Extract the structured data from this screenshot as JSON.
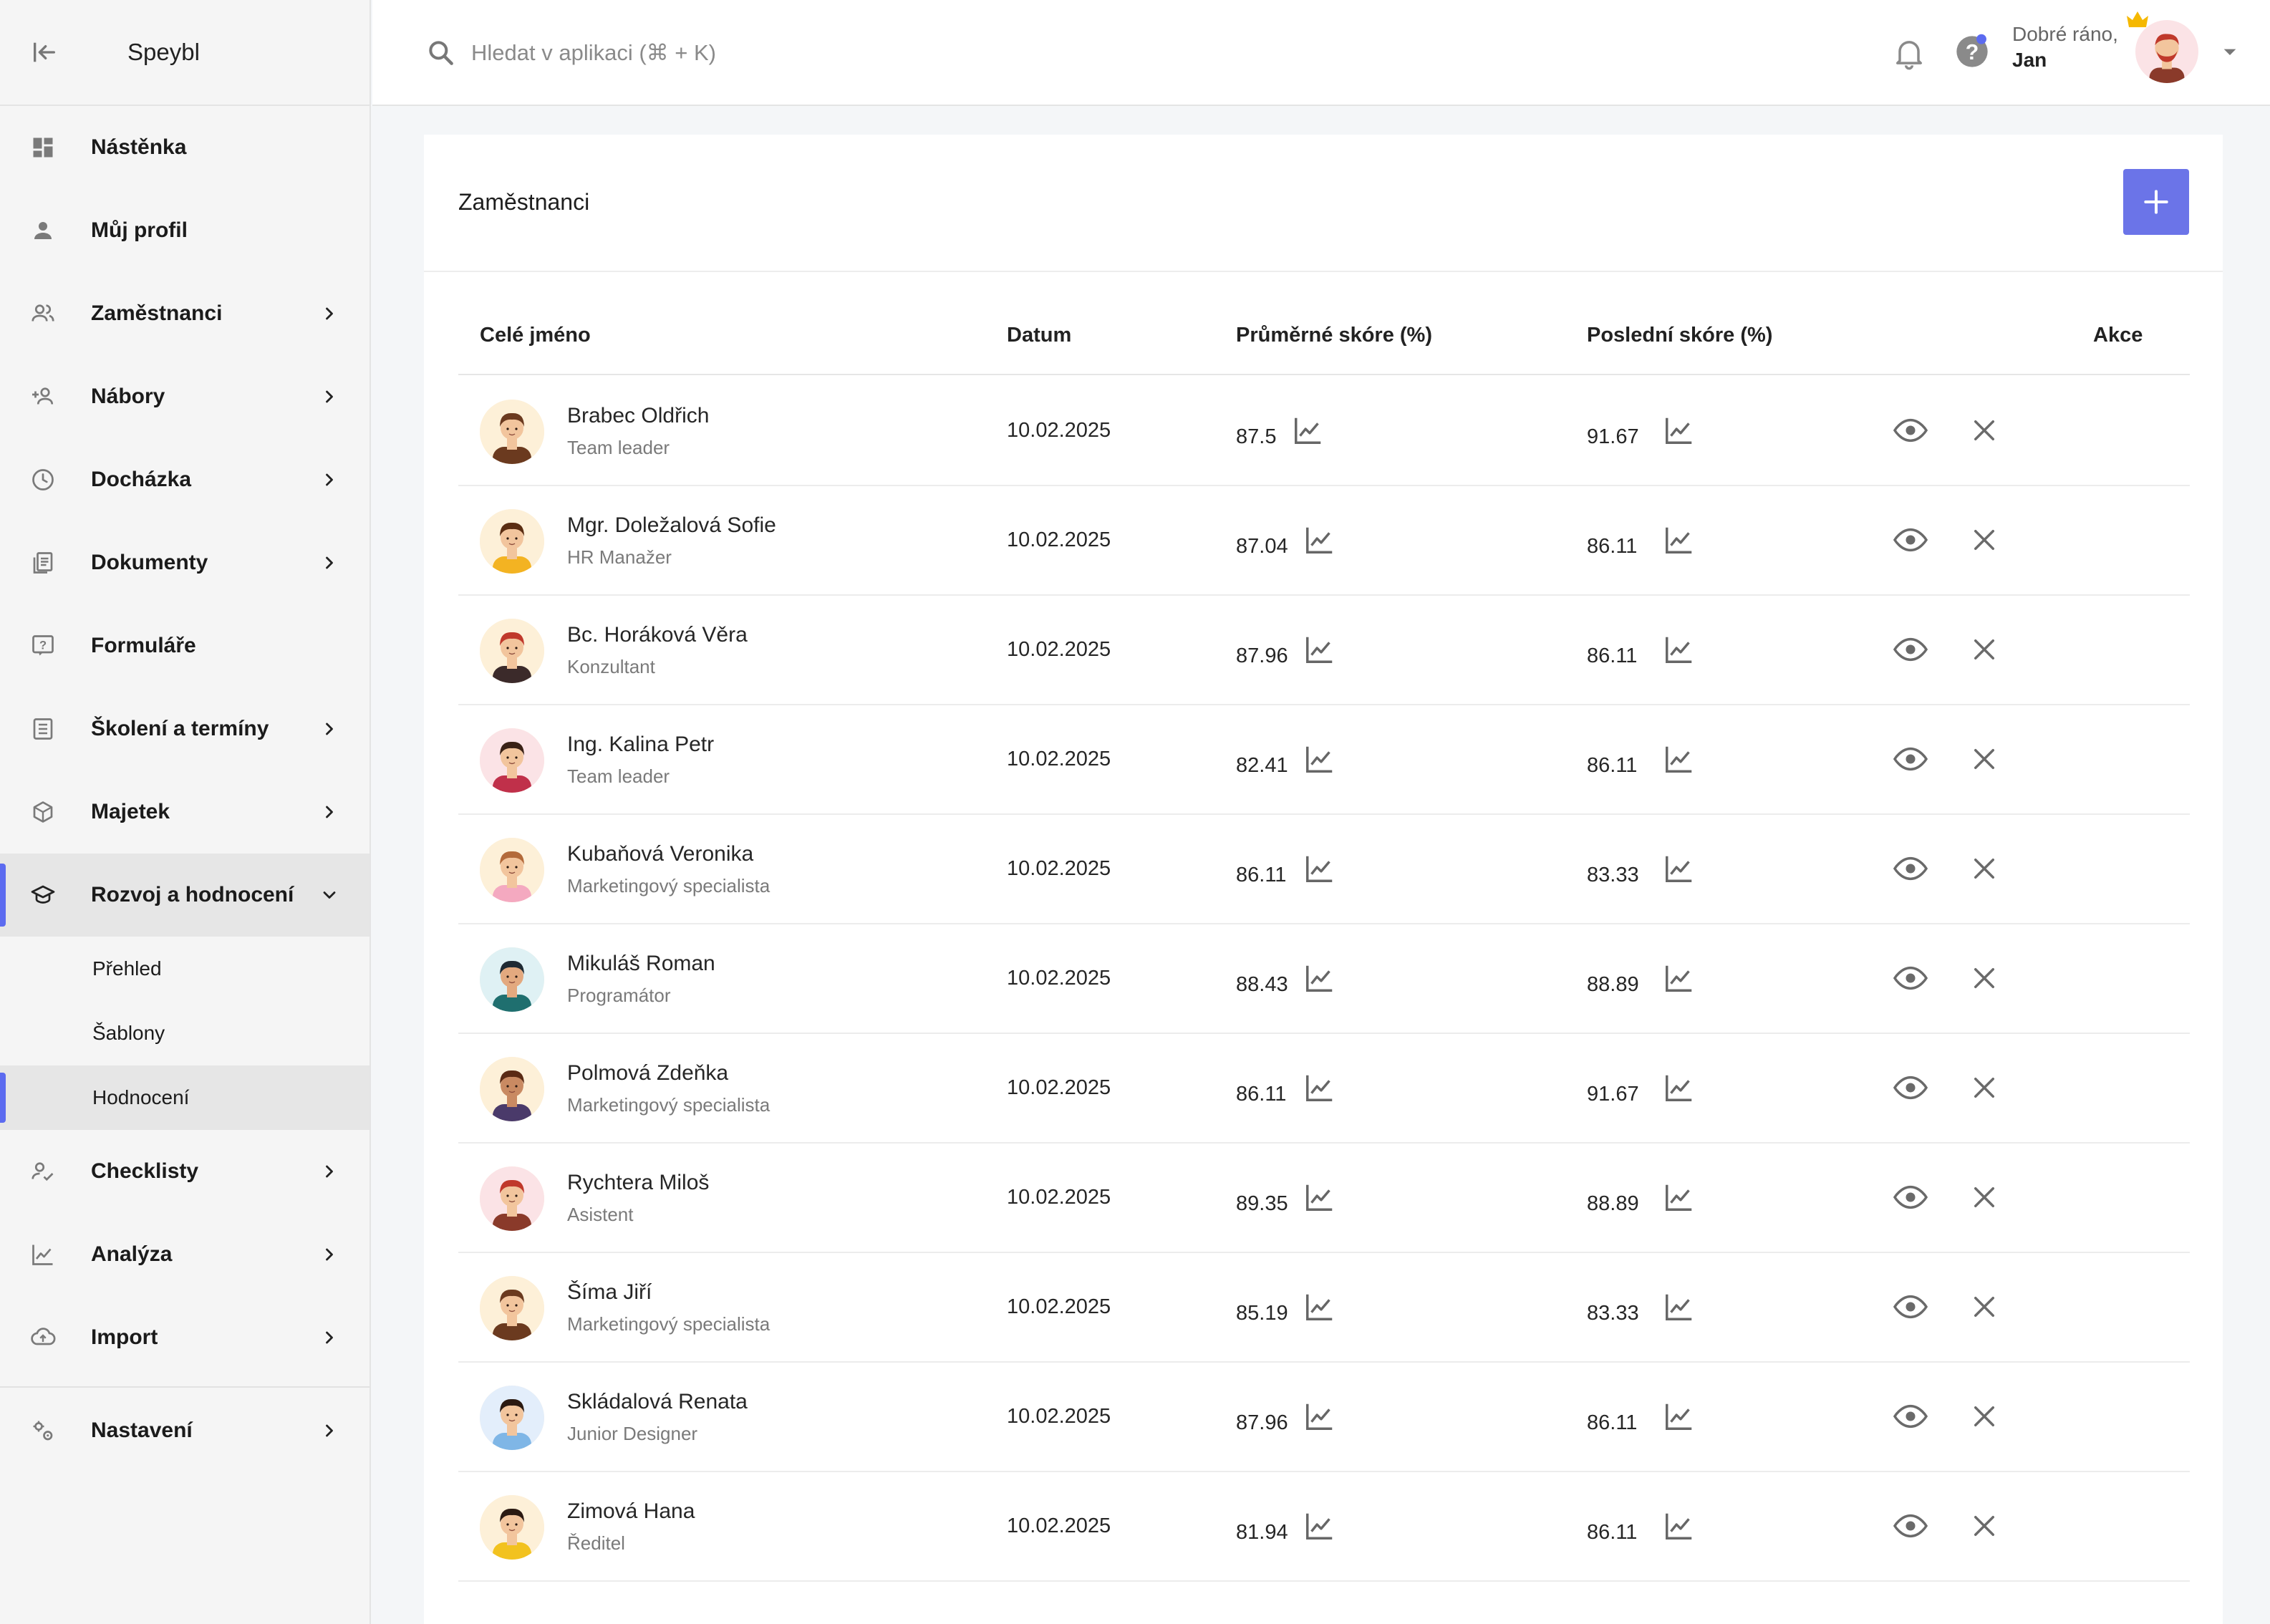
{
  "app": {
    "brand": "Speybl"
  },
  "sidebar": {
    "items": [
      {
        "label": "Nástěnka",
        "icon": "dashboard-icon",
        "chevron": false
      },
      {
        "label": "Můj profil",
        "icon": "person-icon",
        "chevron": false
      },
      {
        "label": "Zaměstnanci",
        "icon": "people-icon",
        "chevron": true
      },
      {
        "label": "Nábory",
        "icon": "group-add-icon",
        "chevron": true
      },
      {
        "label": "Docházka",
        "icon": "clock-icon",
        "chevron": true
      },
      {
        "label": "Dokumenty",
        "icon": "documents-icon",
        "chevron": true
      },
      {
        "label": "Formuláře",
        "icon": "form-icon",
        "chevron": false
      },
      {
        "label": "Školení a termíny",
        "icon": "list-icon",
        "chevron": true
      },
      {
        "label": "Majetek",
        "icon": "box-icon",
        "chevron": true
      },
      {
        "label": "Rozvoj a hodnocení",
        "icon": "school-icon",
        "chevron": true,
        "expanded": true,
        "active": true
      }
    ],
    "subitems": [
      {
        "label": "Přehled",
        "active": false
      },
      {
        "label": "Šablony",
        "active": false
      },
      {
        "label": "Hodnocení",
        "active": true
      }
    ],
    "items_after": [
      {
        "label": "Checklisty",
        "icon": "checklist-icon",
        "chevron": true
      },
      {
        "label": "Analýza",
        "icon": "analytics-icon",
        "chevron": true
      },
      {
        "label": "Import",
        "icon": "cloud-upload-icon",
        "chevron": true
      }
    ],
    "settings": {
      "label": "Nastavení",
      "icon": "settings-icon",
      "chevron": true
    }
  },
  "topbar": {
    "search_placeholder": "Hledat v aplikaci (⌘ + K)",
    "greeting": "Dobré ráno,",
    "user_name": "Jan"
  },
  "page": {
    "title": "Zaměstnanci",
    "columns": {
      "name": "Celé jméno",
      "date": "Datum",
      "avg": "Průměrné skóre (%)",
      "last": "Poslední skóre (%)",
      "actions": "Akce"
    }
  },
  "colors": {
    "accent": "#5c6bf0",
    "add_button": "#6b74e8"
  },
  "employees": [
    {
      "name": "Brabec Oldřich",
      "role": "Team leader",
      "date": "10.02.2025",
      "avg": "87.5",
      "last": "91.67",
      "skin": "#f2c59d",
      "hair": "#6b3a1f",
      "shirt": "#6b3a1f",
      "bg": "#fdf0d8"
    },
    {
      "name": "Mgr. Doležalová Sofie",
      "role": "HR Manažer",
      "date": "10.02.2025",
      "avg": "87.04",
      "last": "86.11",
      "skin": "#f2c59d",
      "hair": "#5a2d12",
      "shirt": "#f3b322",
      "bg": "#fdf0d8"
    },
    {
      "name": "Bc. Horáková Věra",
      "role": "Konzultant",
      "date": "10.02.2025",
      "avg": "87.96",
      "last": "86.11",
      "skin": "#f2c59d",
      "hair": "#c0392b",
      "shirt": "#3b2a2a",
      "bg": "#fdf0d8"
    },
    {
      "name": "Ing. Kalina Petr",
      "role": "Team leader",
      "date": "10.02.2025",
      "avg": "82.41",
      "last": "86.11",
      "skin": "#f2c59d",
      "hair": "#3a2216",
      "shirt": "#c0304a",
      "bg": "#fbe3e6"
    },
    {
      "name": "Kubaňová Veronika",
      "role": "Marketingový specialista",
      "date": "10.02.2025",
      "avg": "86.11",
      "last": "83.33",
      "skin": "#f2c59d",
      "hair": "#b36a3a",
      "shirt": "#f4a9c0",
      "bg": "#fdf0d8"
    },
    {
      "name": "Mikuláš Roman",
      "role": "Programátor",
      "date": "10.02.2025",
      "avg": "88.43",
      "last": "88.89",
      "skin": "#e3a97f",
      "hair": "#1f2a33",
      "shirt": "#1f6f6f",
      "bg": "#dff1f4"
    },
    {
      "name": "Polmová Zdeňka",
      "role": "Marketingový specialista",
      "date": "10.02.2025",
      "avg": "86.11",
      "last": "91.67",
      "skin": "#c98a62",
      "hair": "#5a2a14",
      "shirt": "#4a3a6a",
      "bg": "#fdf0d8"
    },
    {
      "name": "Rychtera Miloš",
      "role": "Asistent",
      "date": "10.02.2025",
      "avg": "89.35",
      "last": "88.89",
      "skin": "#f2c59d",
      "hair": "#c0392b",
      "shirt": "#8a3a2a",
      "bg": "#fbe3e6"
    },
    {
      "name": "Šíma Jiří",
      "role": "Marketingový specialista",
      "date": "10.02.2025",
      "avg": "85.19",
      "last": "83.33",
      "skin": "#f2c59d",
      "hair": "#6b3a1f",
      "shirt": "#6b3a1f",
      "bg": "#fdf0d8"
    },
    {
      "name": "Skládalová Renata",
      "role": "Junior Designer",
      "date": "10.02.2025",
      "avg": "87.96",
      "last": "86.11",
      "skin": "#f2c59d",
      "hair": "#2b1a12",
      "shirt": "#7fb6e6",
      "bg": "#e3eefb"
    },
    {
      "name": "Zimová Hana",
      "role": "Ředitel",
      "date": "10.02.2025",
      "avg": "81.94",
      "last": "86.11",
      "skin": "#f2c59d",
      "hair": "#2b1a12",
      "shirt": "#f2c21f",
      "bg": "#fdf0d8"
    }
  ]
}
